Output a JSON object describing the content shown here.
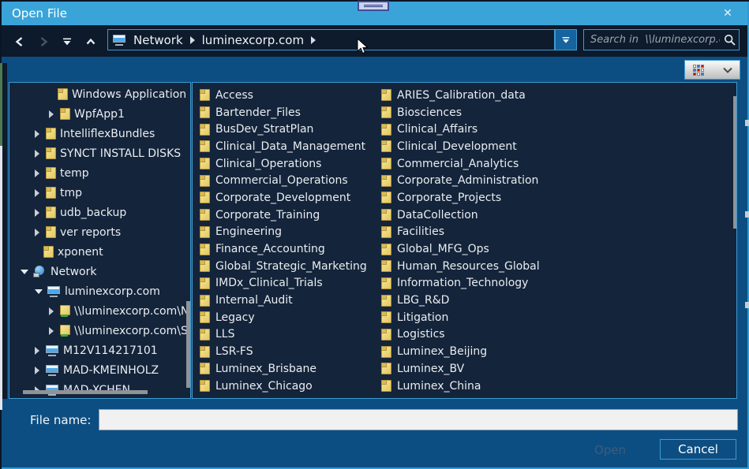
{
  "window": {
    "title": "Open File",
    "close_icon": "✕"
  },
  "toolbar": {
    "breadcrumb": {
      "root": "Network",
      "segment": "luminexcorp.com"
    },
    "search_placeholder": "Search in  \\\\luminexcorp.com\\stor"
  },
  "tree": {
    "items": [
      {
        "label": "Windows Application",
        "level": 2,
        "icon": "folder",
        "expander": "none"
      },
      {
        "label": "WpfApp1",
        "level": 2,
        "icon": "folder",
        "expander": "collapsed"
      },
      {
        "label": "IntelliflexBundles",
        "level": 1,
        "icon": "folder",
        "expander": "collapsed"
      },
      {
        "label": "SYNCT INSTALL DISKS",
        "level": 1,
        "icon": "folder",
        "expander": "collapsed"
      },
      {
        "label": "temp",
        "level": 1,
        "icon": "folder",
        "expander": "collapsed"
      },
      {
        "label": "tmp",
        "level": 1,
        "icon": "folder",
        "expander": "collapsed"
      },
      {
        "label": "udb_backup",
        "level": 1,
        "icon": "folder",
        "expander": "collapsed"
      },
      {
        "label": "ver reports",
        "level": 1,
        "icon": "folder",
        "expander": "collapsed"
      },
      {
        "label": "xponent",
        "level": 1,
        "icon": "folder",
        "expander": "none"
      },
      {
        "label": "Network",
        "level": 0,
        "icon": "network",
        "expander": "expanded"
      },
      {
        "label": "luminexcorp.com",
        "level": 1,
        "icon": "computer",
        "expander": "expanded"
      },
      {
        "label": "\\\\luminexcorp.com\\NET",
        "level": 2,
        "icon": "shared-folder",
        "expander": "collapsed"
      },
      {
        "label": "\\\\luminexcorp.com\\SYS",
        "level": 2,
        "icon": "shared-folder",
        "expander": "collapsed"
      },
      {
        "label": "M12V114217101",
        "level": 1,
        "icon": "computer",
        "expander": "collapsed"
      },
      {
        "label": "MAD-KMEINHOLZ",
        "level": 1,
        "icon": "computer",
        "expander": "collapsed"
      },
      {
        "label": "MAD-XCHEN",
        "level": 1,
        "icon": "computer",
        "expander": "collapsed"
      }
    ]
  },
  "files": {
    "column1": [
      "Access",
      "Bartender_Files",
      "BusDev_StratPlan",
      "Clinical_Data_Management",
      "Clinical_Operations",
      "Commercial_Operations",
      "Corporate_Development",
      "Corporate_Training",
      "Engineering",
      "Finance_Accounting",
      "Global_Strategic_Marketing",
      "IMDx_Clinical_Trials",
      "Internal_Audit",
      "Legacy",
      "LLS",
      "LSR-FS",
      "Luminex_Brisbane",
      "Luminex_Chicago"
    ],
    "column2": [
      "ARIES_Calibration_data",
      "Biosciences",
      "Clinical_Affairs",
      "Clinical_Development",
      "Commercial_Analytics",
      "Corporate_Administration",
      "Corporate_Projects",
      "DataCollection",
      "Facilities",
      "Global_MFG_Ops",
      "Human_Resources_Global",
      "Information_Technology",
      "LBG_R&D",
      "Litigation",
      "Logistics",
      "Luminex_Beijing",
      "Luminex_BV",
      "Luminex_China"
    ]
  },
  "footer": {
    "file_name_label": "File name:",
    "file_name_value": "",
    "open_label": "Open",
    "cancel_label": "Cancel"
  },
  "colors": {
    "titlebar": "#3aa4d9",
    "chrome": "#0d4e82",
    "panel_bg": "#14243a",
    "panel_border": "#3d9bd1",
    "navbar_bg": "#0c1a2b",
    "folder_yellow": "#efd87a",
    "text": "#e9edf2",
    "disabled_text": "#3d5c7d",
    "scrollbar": "#8f9398"
  }
}
